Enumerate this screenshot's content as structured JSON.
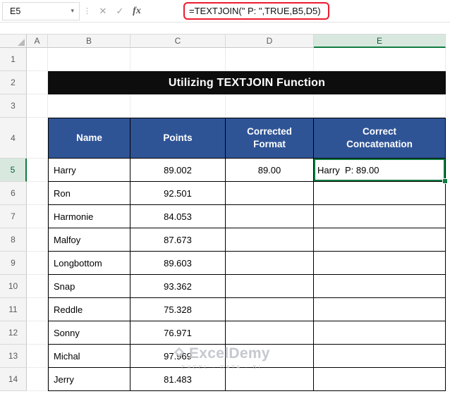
{
  "formula_bar": {
    "name_box_value": "E5",
    "formula": "=TEXTJOIN(\" P: \",TRUE,B5,D5)",
    "icons": {
      "dropdown": "▾",
      "separator": "⋮",
      "cancel": "✕",
      "confirm": "✓",
      "insert_function": "fx"
    }
  },
  "grid": {
    "column_headers": [
      "A",
      "B",
      "C",
      "D",
      "E"
    ],
    "row_headers": [
      "1",
      "2",
      "3",
      "4",
      "5",
      "6",
      "7",
      "8",
      "9",
      "10",
      "11",
      "12",
      "13",
      "14"
    ],
    "selected_cell": "E5"
  },
  "banner": {
    "title": "Utilizing TEXTJOIN Function"
  },
  "table": {
    "headers": [
      "Name",
      "Points",
      "Corrected\nFormat",
      "Correct\nConcatenation"
    ],
    "rows": [
      {
        "name": "Harry",
        "points": "89.002",
        "corrected": "89.00",
        "concat": "Harry  P: 89.00"
      },
      {
        "name": "Ron",
        "points": "92.501",
        "corrected": "",
        "concat": ""
      },
      {
        "name": "Harmonie",
        "points": "84.053",
        "corrected": "",
        "concat": ""
      },
      {
        "name": "Malfoy",
        "points": "87.673",
        "corrected": "",
        "concat": ""
      },
      {
        "name": "Longbottom",
        "points": "89.603",
        "corrected": "",
        "concat": ""
      },
      {
        "name": "Snap",
        "points": "93.362",
        "corrected": "",
        "concat": ""
      },
      {
        "name": "Reddle",
        "points": "75.328",
        "corrected": "",
        "concat": ""
      },
      {
        "name": "Sonny",
        "points": "76.971",
        "corrected": "",
        "concat": ""
      },
      {
        "name": "Michal",
        "points": "97.969",
        "corrected": "",
        "concat": ""
      },
      {
        "name": "Jerry",
        "points": "81.483",
        "corrected": "",
        "concat": ""
      }
    ]
  },
  "watermark": {
    "name": "ExcelDemy",
    "tagline": "EXCEL · DATA · BI"
  },
  "colors": {
    "header_blue": "#2F5496",
    "banner_black": "#0D0D0D",
    "selection_green": "#107C41",
    "formula_border_red": "#EC1C2E",
    "header_highlight": "#D9E8DF"
  }
}
